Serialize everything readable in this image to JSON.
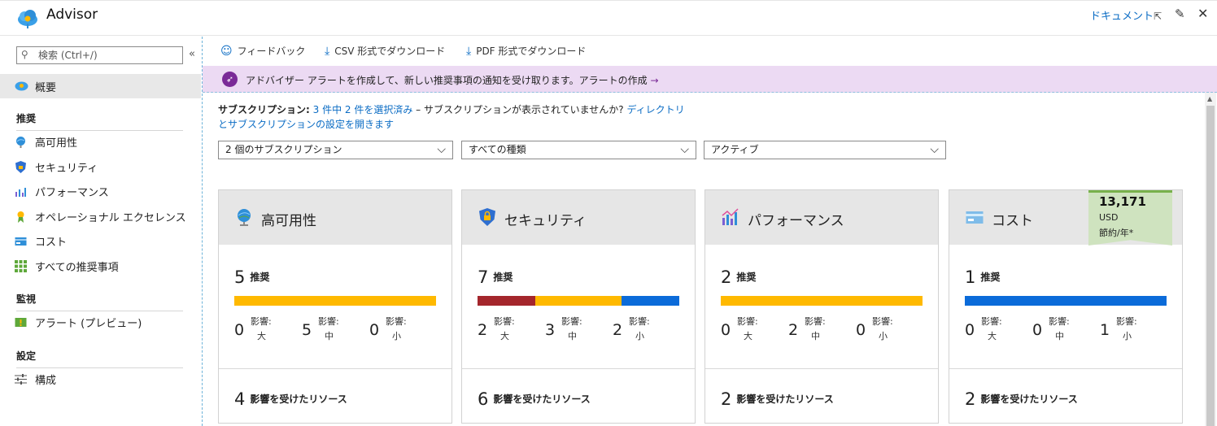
{
  "app": {
    "title": "Advisor",
    "docs_link": "ドキュメント"
  },
  "sidebar": {
    "search_placeholder": "検索 (Ctrl+/)",
    "overview": "概要",
    "sections": {
      "recommendations": "推奨",
      "monitoring": "監視",
      "settings": "設定"
    },
    "items": [
      {
        "label": "高可用性"
      },
      {
        "label": "セキュリティ"
      },
      {
        "label": "パフォーマンス"
      },
      {
        "label": "オペレーショナル エクセレンス"
      },
      {
        "label": "コスト"
      },
      {
        "label": "すべての推奨事項"
      }
    ],
    "monitoring_items": [
      {
        "label": "アラート (プレビュー)"
      }
    ],
    "settings_items": [
      {
        "label": "構成"
      }
    ]
  },
  "toolbar": {
    "feedback": "フィードバック",
    "csv": "CSV 形式でダウンロード",
    "pdf": "PDF 形式でダウンロード"
  },
  "banner": {
    "text": "アドバイザー アラートを作成して、新しい推奨事項の通知を受け取ります。",
    "link": "アラートの作成",
    "arrow": "→"
  },
  "subscription": {
    "label": "サブスクリプション:",
    "selected": "3 件中 2 件を選択済み",
    "question": " – サブスクリプションが表示されていませんか?",
    "link1": "ディレクトリ",
    "link2": "とサブスクリプションの設定を開きます"
  },
  "filters": {
    "subscriptions": "2 個のサブスクリプション",
    "types": "すべての種類",
    "status": "アクティブ"
  },
  "cards": [
    {
      "title": "高可用性",
      "rec_count": "5",
      "rec_label": "推奨",
      "bar": [
        {
          "color": "#ffb900",
          "share": 1.0
        }
      ],
      "impacts": [
        {
          "n": "0",
          "t1": "影響:",
          "t2": "大"
        },
        {
          "n": "5",
          "t1": "影響:",
          "t2": "中"
        },
        {
          "n": "0",
          "t1": "影響:",
          "t2": "小"
        }
      ],
      "res_count": "4",
      "res_label": "影響を受けたリソース"
    },
    {
      "title": "セキュリティ",
      "rec_count": "7",
      "rec_label": "推奨",
      "bar": [
        {
          "color": "#a4262c",
          "share": 0.2857
        },
        {
          "color": "#ffb900",
          "share": 0.4286
        },
        {
          "color": "#0b6bd9",
          "share": 0.2857
        }
      ],
      "impacts": [
        {
          "n": "2",
          "t1": "影響:",
          "t2": "大"
        },
        {
          "n": "3",
          "t1": "影響:",
          "t2": "中"
        },
        {
          "n": "2",
          "t1": "影響:",
          "t2": "小"
        }
      ],
      "res_count": "6",
      "res_label": "影響を受けたリソース"
    },
    {
      "title": "パフォーマンス",
      "rec_count": "2",
      "rec_label": "推奨",
      "bar": [
        {
          "color": "#ffb900",
          "share": 1.0
        }
      ],
      "impacts": [
        {
          "n": "0",
          "t1": "影響:",
          "t2": "大"
        },
        {
          "n": "2",
          "t1": "影響:",
          "t2": "中"
        },
        {
          "n": "0",
          "t1": "影響:",
          "t2": "小"
        }
      ],
      "res_count": "2",
      "res_label": "影響を受けたリソース"
    },
    {
      "title": "コスト",
      "rec_count": "1",
      "rec_label": "推奨",
      "bar": [
        {
          "color": "#0b6bd9",
          "share": 1.0
        }
      ],
      "impacts": [
        {
          "n": "0",
          "t1": "影響:",
          "t2": "大"
        },
        {
          "n": "0",
          "t1": "影響:",
          "t2": "中"
        },
        {
          "n": "1",
          "t1": "影響:",
          "t2": "小"
        }
      ],
      "res_count": "2",
      "res_label": "影響を受けたリソース",
      "savings": {
        "amount": "13,171",
        "currency": "USD",
        "period": "節約/年*"
      }
    }
  ]
}
